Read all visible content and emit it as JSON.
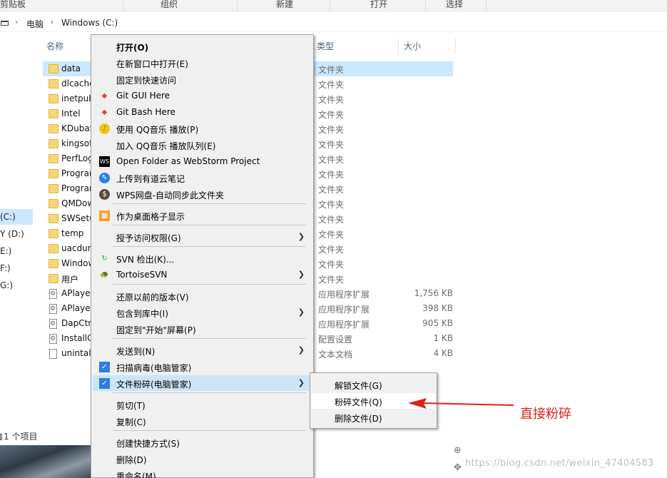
{
  "ribbon": {
    "groups": [
      "剪贴板",
      "组织",
      "新建",
      "打开",
      "选择"
    ]
  },
  "address": {
    "crumbs": [
      "电脑",
      "Windows (C:)"
    ]
  },
  "nav": {
    "items": [
      {
        "label": "(C:)",
        "selected": true
      },
      {
        "label": "Y (D:)",
        "selected": false
      },
      {
        "label": "E:)",
        "selected": false
      },
      {
        "label": "F:)",
        "selected": false
      },
      {
        "label": "G:)",
        "selected": false
      }
    ]
  },
  "list": {
    "columns": {
      "name": "名称",
      "type": "类型",
      "size": "大小"
    },
    "rows": [
      {
        "name": "data",
        "type": "文件夹",
        "size": "",
        "icon": "folder",
        "selected": true
      },
      {
        "name": "dlcache",
        "type": "文件夹",
        "size": "",
        "icon": "folder"
      },
      {
        "name": "inetpub",
        "type": "文件夹",
        "size": "",
        "icon": "folder"
      },
      {
        "name": "Intel",
        "type": "文件夹",
        "size": "",
        "icon": "folder"
      },
      {
        "name": "KDubaS",
        "type": "文件夹",
        "size": "",
        "icon": "folder"
      },
      {
        "name": "kingsoft",
        "type": "文件夹",
        "size": "",
        "icon": "folder"
      },
      {
        "name": "PerfLogs",
        "type": "文件夹",
        "size": "",
        "icon": "folder"
      },
      {
        "name": "Program",
        "type": "文件夹",
        "size": "",
        "icon": "folder"
      },
      {
        "name": "Program",
        "type": "文件夹",
        "size": "",
        "icon": "folder"
      },
      {
        "name": "QMDow",
        "type": "文件夹",
        "size": "",
        "icon": "folder"
      },
      {
        "name": "SWSetu",
        "type": "文件夹",
        "size": "",
        "icon": "folder"
      },
      {
        "name": "temp",
        "type": "文件夹",
        "size": "",
        "icon": "folder"
      },
      {
        "name": "uacdum",
        "type": "文件夹",
        "size": "",
        "icon": "folder"
      },
      {
        "name": "Window",
        "type": "文件夹",
        "size": "",
        "icon": "folder"
      },
      {
        "name": "用户",
        "type": "文件夹",
        "size": "",
        "icon": "folder"
      },
      {
        "name": "APlayer",
        "type": "应用程序扩展",
        "size": "1,756 KB",
        "icon": "dll"
      },
      {
        "name": "APlayer",
        "type": "应用程序扩展",
        "size": "398 KB",
        "icon": "dll"
      },
      {
        "name": "DapCtrl",
        "type": "应用程序扩展",
        "size": "905 KB",
        "icon": "dll"
      },
      {
        "name": "InstallC",
        "type": "配置设置",
        "size": "1 KB",
        "icon": "dll"
      },
      {
        "name": "unintall",
        "type": "文本文档",
        "size": "4 KB",
        "icon": "file"
      }
    ]
  },
  "status": {
    "count": "1 个项目"
  },
  "menu": {
    "items": [
      {
        "label": "打开(O)",
        "bold": true
      },
      {
        "label": "在新窗口中打开(E)"
      },
      {
        "label": "固定到快速访问"
      },
      {
        "label": "Git GUI Here",
        "icon": "git-icon"
      },
      {
        "label": "Git Bash Here",
        "icon": "git-icon"
      },
      {
        "label": "使用 QQ音乐 播放(P)",
        "icon": "qqmusic-icon"
      },
      {
        "label": "加入 QQ音乐 播放队列(E)"
      },
      {
        "label": "Open Folder as WebStorm Project",
        "icon": "webstorm-icon"
      },
      {
        "label": "上传到有道云笔记",
        "icon": "youdao-icon"
      },
      {
        "label": "WPS网盘-自动同步此文件夹",
        "icon": "wps-icon"
      },
      {
        "label": "作为桌面格子显示",
        "icon": "grid-icon"
      },
      {
        "label": "授予访问权限(G)",
        "submenu": true
      },
      {
        "label": "SVN 检出(K)...",
        "icon": "svn-icon"
      },
      {
        "label": "TortoiseSVN",
        "icon": "tortoise-icon",
        "submenu": true
      },
      {
        "label": "还原以前的版本(V)"
      },
      {
        "label": "包含到库中(I)",
        "submenu": true
      },
      {
        "label": "固定到\"开始\"屏幕(P)"
      },
      {
        "label": "发送到(N)",
        "submenu": true
      },
      {
        "label": "扫描病毒(电脑管家)",
        "icon": "shield-icon"
      },
      {
        "label": "文件粉碎(电脑管家)",
        "icon": "shield-icon",
        "submenu": true,
        "highlighted": true
      },
      {
        "label": "剪切(T)"
      },
      {
        "label": "复制(C)"
      },
      {
        "label": "创建快捷方式(S)"
      },
      {
        "label": "删除(D)"
      },
      {
        "label": "重命名(M)"
      }
    ]
  },
  "submenu": {
    "items": [
      {
        "label": "解锁文件(G)"
      },
      {
        "label": "粉碎文件(Q)",
        "highlighted": true
      },
      {
        "label": "删除文件(D)"
      }
    ]
  },
  "annotation": {
    "text": "直接粉碎"
  },
  "watermark": {
    "text": "https://blog.csdn.net/weixin_47404583"
  },
  "colors": {
    "selection": "#cce8ff",
    "annotation": "#e0201a",
    "menu_bg": "#f0f0f0"
  }
}
